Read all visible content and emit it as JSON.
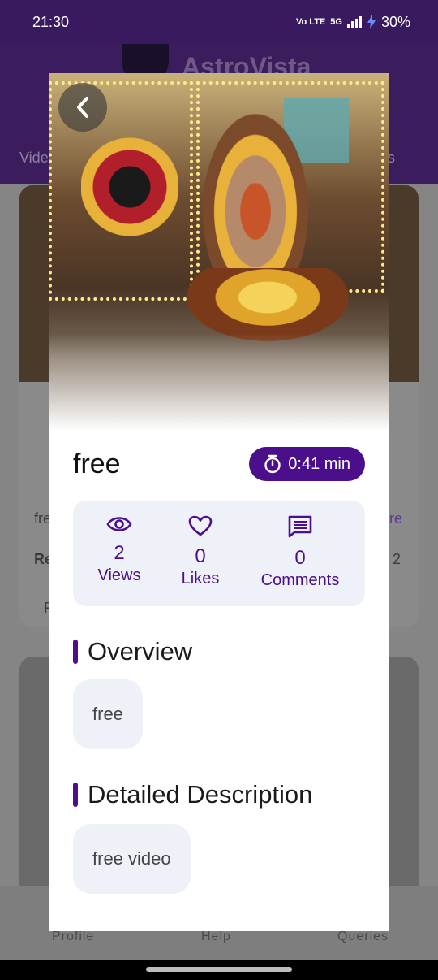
{
  "status_bar": {
    "time": "21:30",
    "network": "5G",
    "volte": "Vo LTE",
    "battery": "30%"
  },
  "background": {
    "brand": "AstroVista",
    "tab_left": "Vide",
    "tab_right": "s",
    "card_text_left": "fre",
    "card_text_right": "re",
    "card_bold_left": "Re",
    "card_right_num": "2",
    "card_small_left": "F",
    "nav": {
      "profile": "Profile",
      "help": "Help",
      "queries": "Queries"
    }
  },
  "modal": {
    "title": "free",
    "duration": "0:41 min",
    "stats": {
      "views_count": "2",
      "views_label": "Views",
      "likes_count": "0",
      "likes_label": "Likes",
      "comments_count": "0",
      "comments_label": "Comments"
    },
    "overview_heading": "Overview",
    "overview_text": "free",
    "description_heading": "Detailed Description",
    "description_text": "free video"
  },
  "colors": {
    "primary": "#4b0f8c",
    "card_bg": "#eef1f7",
    "status_bar": "#3a1a5e"
  }
}
